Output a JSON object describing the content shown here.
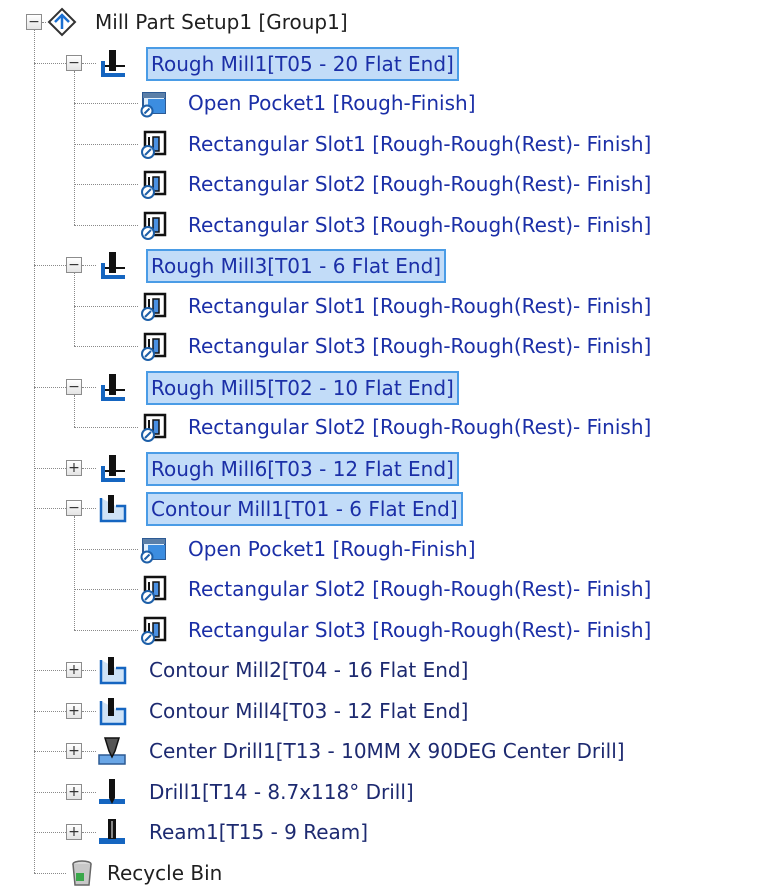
{
  "root": {
    "label": "Mill Part Setup1 [Group1]",
    "expander": "−",
    "icon": "mill-setup-icon"
  },
  "operations": [
    {
      "label": "Rough Mill1[T05 - 20 Flat End]",
      "icon": "rough-mill-icon",
      "selected": true,
      "expander": "−",
      "features": [
        {
          "label": "Open Pocket1 [Rough-Finish]",
          "icon": "open-pocket-icon"
        },
        {
          "label": "Rectangular Slot1 [Rough-Rough(Rest)- Finish]",
          "icon": "rectangular-slot-icon"
        },
        {
          "label": "Rectangular Slot2 [Rough-Rough(Rest)- Finish]",
          "icon": "rectangular-slot-icon"
        },
        {
          "label": "Rectangular Slot3 [Rough-Rough(Rest)- Finish]",
          "icon": "rectangular-slot-icon"
        }
      ]
    },
    {
      "label": "Rough Mill3[T01 - 6 Flat End]",
      "icon": "rough-mill-icon",
      "selected": true,
      "expander": "−",
      "features": [
        {
          "label": "Rectangular Slot1 [Rough-Rough(Rest)- Finish]",
          "icon": "rectangular-slot-icon"
        },
        {
          "label": "Rectangular Slot3 [Rough-Rough(Rest)- Finish]",
          "icon": "rectangular-slot-icon"
        }
      ]
    },
    {
      "label": "Rough Mill5[T02 - 10 Flat End]",
      "icon": "rough-mill-icon",
      "selected": true,
      "expander": "−",
      "features": [
        {
          "label": "Rectangular Slot2 [Rough-Rough(Rest)- Finish]",
          "icon": "rectangular-slot-icon"
        }
      ]
    },
    {
      "label": "Rough Mill6[T03 - 12 Flat End]",
      "icon": "rough-mill-icon",
      "selected": true,
      "expander": "+",
      "features": []
    },
    {
      "label": "Contour Mill1[T01 - 6 Flat End]",
      "icon": "contour-mill-icon",
      "selected": true,
      "expander": "−",
      "features": [
        {
          "label": "Open Pocket1 [Rough-Finish]",
          "icon": "open-pocket-icon"
        },
        {
          "label": "Rectangular Slot2 [Rough-Rough(Rest)- Finish]",
          "icon": "rectangular-slot-icon"
        },
        {
          "label": "Rectangular Slot3 [Rough-Rough(Rest)- Finish]",
          "icon": "rectangular-slot-icon"
        }
      ]
    },
    {
      "label": "Contour Mill2[T04 - 16 Flat End]",
      "icon": "contour-mill-icon",
      "selected": false,
      "expander": "+",
      "features": []
    },
    {
      "label": "Contour Mill4[T03 - 12 Flat End]",
      "icon": "contour-mill-icon",
      "selected": false,
      "expander": "+",
      "features": []
    },
    {
      "label": "Center Drill1[T13 - 10MM X 90DEG Center Drill]",
      "icon": "center-drill-icon",
      "selected": false,
      "expander": "+",
      "features": []
    },
    {
      "label": "Drill1[T14 - 8.7x118° Drill]",
      "icon": "drill-icon",
      "selected": false,
      "expander": "+",
      "features": []
    },
    {
      "label": "Ream1[T15 - 9 Ream]",
      "icon": "ream-icon",
      "selected": false,
      "expander": "+",
      "features": []
    }
  ],
  "recycle_bin": {
    "label": "Recycle Bin",
    "icon": "recycle-bin-icon"
  },
  "colors": {
    "selection_fill": "#c2dcf8",
    "selection_border": "#4a9ce6",
    "link_text": "#1b2fa7"
  }
}
